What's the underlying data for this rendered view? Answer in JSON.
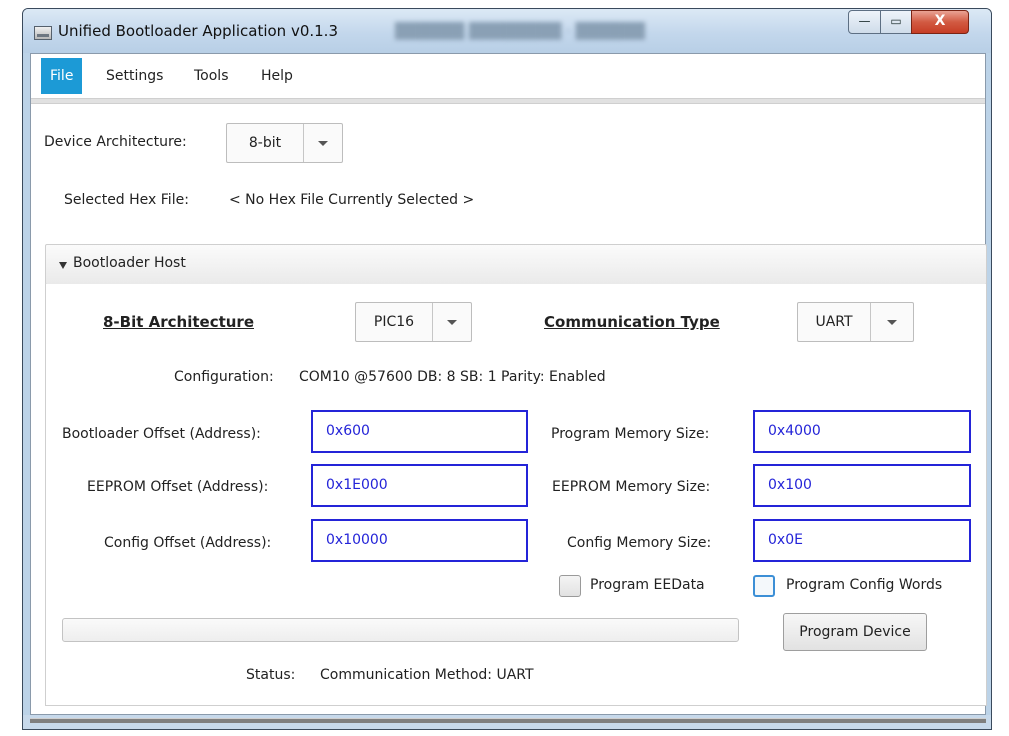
{
  "window": {
    "title": "Unified Bootloader Application v0.1.3",
    "minimize_glyph": "—",
    "maximize_glyph": "▭",
    "close_glyph": "X"
  },
  "menu": [
    "File",
    "Settings",
    "Tools",
    "Help"
  ],
  "device_architecture": {
    "label": "Device Architecture:",
    "value": "8-bit"
  },
  "hex_file": {
    "label": "Selected Hex File:",
    "value": "< No Hex File Currently Selected >"
  },
  "bootloader_host": {
    "title": "Bootloader Host",
    "architecture_heading": "8-Bit Architecture",
    "architecture_value": "PIC16",
    "comm_heading": "Communication Type",
    "comm_value": "UART",
    "configuration": {
      "label": "Configuration:",
      "value": "COM10 @57600 DB: 8 SB: 1 Parity: Enabled"
    },
    "bootloader_offset": {
      "label": "Bootloader Offset (Address):",
      "value": "0x600"
    },
    "eeprom_offset": {
      "label": "EEPROM Offset (Address):",
      "value": "0x1E000"
    },
    "config_offset": {
      "label": "Config Offset (Address):",
      "value": "0x10000"
    },
    "program_memory_size": {
      "label": "Program Memory Size:",
      "value": "0x4000"
    },
    "eeprom_memory_size": {
      "label": "EEPROM Memory Size:",
      "value": "0x100"
    },
    "config_memory_size": {
      "label": "Config Memory Size:",
      "value": "0x0E"
    },
    "program_eedata": {
      "label": "Program EEData",
      "checked": false
    },
    "program_config_words": {
      "label": "Program Config Words",
      "checked": false
    },
    "progress": 0,
    "program_button": "Program Device",
    "status": {
      "label": "Status:",
      "value": "Communication Method: UART"
    }
  },
  "colors": {
    "menu_active": "#1c9ad6",
    "input_border": "#2424d8",
    "input_text": "#2424d8"
  }
}
